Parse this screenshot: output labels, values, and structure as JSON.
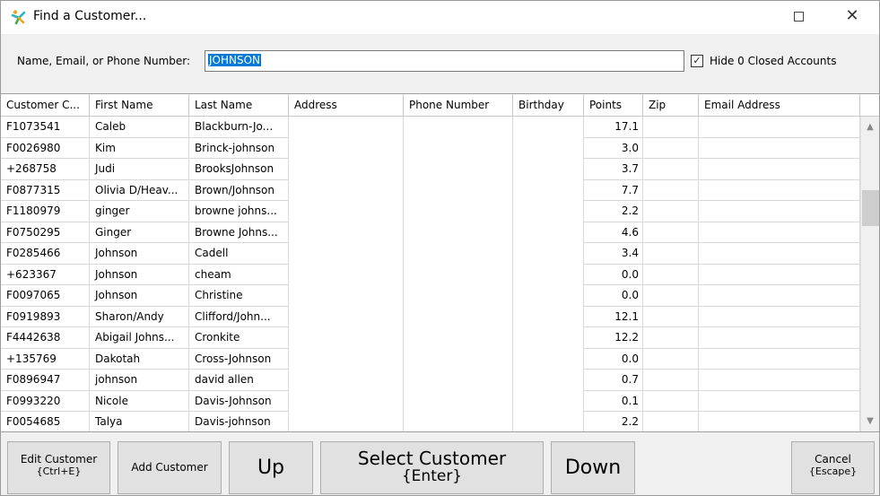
{
  "window": {
    "title": "Find a Customer...",
    "maximize_glyph": "",
    "close_glyph": "✕",
    "app_icon": "running-figure-icon"
  },
  "search": {
    "label": "Name, Email, or Phone Number:",
    "value": "JOHNSON",
    "hide_closed_checked": true,
    "hide_closed_label": "Hide 0 Closed Accounts"
  },
  "grid": {
    "columns": [
      "Customer C...",
      "First Name",
      "Last Name",
      "Address",
      "Phone Number",
      "Birthday",
      "Points",
      "Zip",
      "Email Address"
    ],
    "rows": [
      [
        "F1073541",
        "Caleb",
        "Blackburn-Jo...",
        "",
        "",
        "",
        "17.1",
        "",
        ""
      ],
      [
        "F0026980",
        "Kim",
        "Brinck-johnson",
        "",
        "",
        "",
        "3.0",
        "",
        ""
      ],
      [
        "+268758",
        "Judi",
        "BrooksJohnson",
        "",
        "",
        "",
        "3.7",
        "",
        ""
      ],
      [
        "F0877315",
        "Olivia D/Heav...",
        "Brown/Johnson",
        "",
        "",
        "",
        "7.7",
        "",
        ""
      ],
      [
        "F1180979",
        "ginger",
        "browne johns...",
        "",
        "",
        "",
        "2.2",
        "",
        ""
      ],
      [
        "F0750295",
        "Ginger",
        "Browne Johns...",
        "",
        "",
        "",
        "4.6",
        "",
        ""
      ],
      [
        "F0285466",
        "Johnson",
        "Cadell",
        "",
        "",
        "",
        "3.4",
        "",
        ""
      ],
      [
        "+623367",
        "Johnson",
        "cheam",
        "",
        "",
        "",
        "0.0",
        "",
        ""
      ],
      [
        "F0097065",
        "Johnson",
        "Christine",
        "",
        "",
        "",
        "0.0",
        "",
        ""
      ],
      [
        "F0919893",
        "Sharon/Andy",
        "Clifford/John...",
        "",
        "",
        "",
        "12.1",
        "",
        ""
      ],
      [
        "F4442638",
        "Abigail Johns...",
        "Cronkite",
        "",
        "",
        "",
        "12.2",
        "",
        ""
      ],
      [
        "+135769",
        "Dakotah",
        "Cross-Johnson",
        "",
        "",
        "",
        "0.0",
        "",
        ""
      ],
      [
        "F0896947",
        "johnson",
        "david allen",
        "",
        "",
        "",
        "0.7",
        "",
        ""
      ],
      [
        "F0993220",
        "Nicole",
        "Davis-Johnson",
        "",
        "",
        "",
        "0.1",
        "",
        ""
      ],
      [
        "F0054685",
        "Talya",
        "Davis-johnson",
        "",
        "",
        "",
        "2.2",
        "",
        ""
      ]
    ]
  },
  "buttons": {
    "edit_line1": "Edit Customer",
    "edit_line2": "{Ctrl+E}",
    "add": "Add Customer",
    "up": "Up",
    "select_line1": "Select Customer",
    "select_line2": "{Enter}",
    "down": "Down",
    "cancel_line1": "Cancel",
    "cancel_line2": "{Escape}"
  }
}
